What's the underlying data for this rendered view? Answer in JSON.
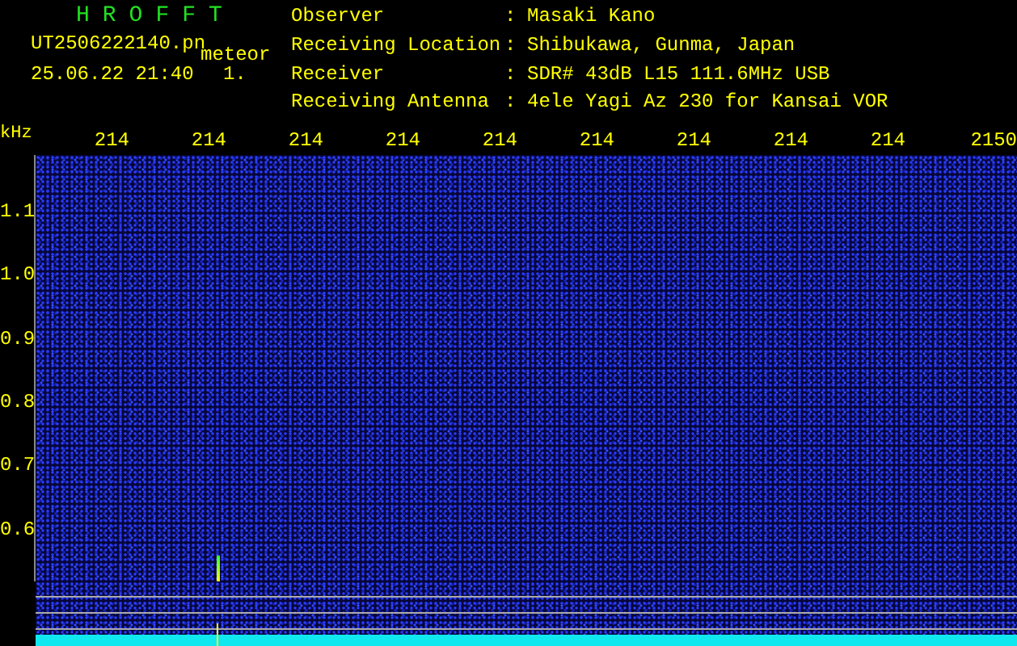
{
  "header": {
    "title": "HROFFT",
    "file_name": "UT2506222140.pn",
    "mode": "meteor",
    "timestamp": "25.06.22 21:40",
    "counter": "1.",
    "info": [
      {
        "label": "Observer",
        "separator": ":",
        "value": "Masaki Kano"
      },
      {
        "label": "Receiving Location",
        "separator": ":",
        "value": "Shibukawa, Gunma, Japan"
      },
      {
        "label": "Receiver",
        "separator": ":",
        "value": "SDR# 43dB L15 111.6MHz USB"
      },
      {
        "label": "Receiving Antenna",
        "separator": ":",
        "value": "4ele Yagi Az 230 for Kansai VOR"
      }
    ]
  },
  "plot": {
    "y_unit": "kHz",
    "x_ticks": [
      "214",
      "214",
      "214",
      "214",
      "214",
      "214",
      "214",
      "214",
      "214",
      "2150"
    ],
    "y_ticks": [
      "1.1",
      "1.0",
      "0.9",
      "0.8",
      "0.7",
      "0.6"
    ]
  }
}
